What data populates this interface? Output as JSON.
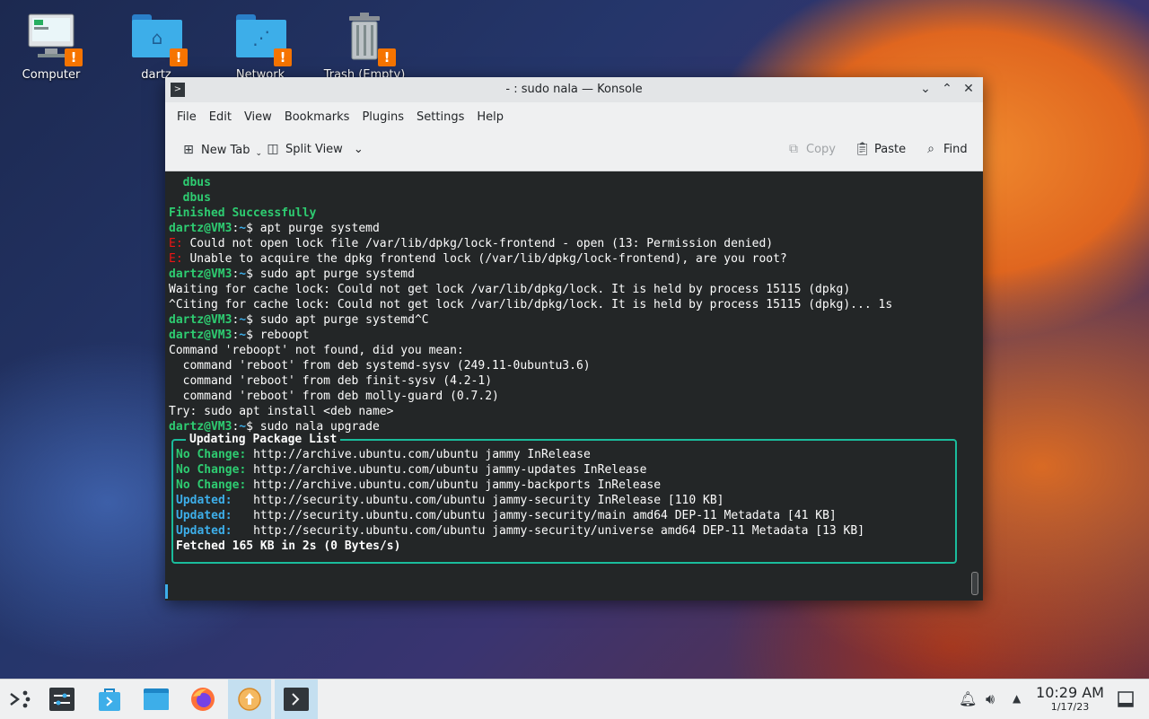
{
  "desktop": {
    "icons": [
      {
        "label": "Computer"
      },
      {
        "label": "dartz"
      },
      {
        "label": "Network"
      },
      {
        "label": "Trash (Empty)"
      }
    ],
    "warn_glyph": "!"
  },
  "window": {
    "title": "- : sudo nala — Konsole",
    "menu": [
      "File",
      "Edit",
      "View",
      "Bookmarks",
      "Plugins",
      "Settings",
      "Help"
    ],
    "toolbar": {
      "new_tab": "New Tab",
      "split_view": "Split View",
      "copy": "Copy",
      "paste": "Paste",
      "find": "Find"
    }
  },
  "terminal": {
    "prompt_user": "dartz@VM3",
    "prompt_path": "~",
    "lines": {
      "l1": "  dbus",
      "l2": "  dbus",
      "l3": "Finished Successfully",
      "l4_cmd": "apt purge systemd",
      "l5_tag": "E:",
      "l5": " Could not open lock file /var/lib/dpkg/lock-frontend - open (13: Permission denied)",
      "l6_tag": "E:",
      "l6": " Unable to acquire the dpkg frontend lock (/var/lib/dpkg/lock-frontend), are you root?",
      "l7_cmd": "sudo apt purge systemd",
      "l8": "Waiting for cache lock: Could not get lock /var/lib/dpkg/lock. It is held by process 15115 (dpkg)",
      "l9": "^Citing for cache lock: Could not get lock /var/lib/dpkg/lock. It is held by process 15115 (dpkg)... 1s",
      "l10_cmd": "sudo apt purge systemd^C",
      "l11_cmd": "reboopt",
      "l12": "Command 'reboopt' not found, did you mean:",
      "l13": "  command 'reboot' from deb systemd-sysv (249.11-0ubuntu3.6)",
      "l14": "  command 'reboot' from deb finit-sysv (4.2-1)",
      "l15": "  command 'reboot' from deb molly-guard (0.7.2)",
      "l16": "Try: sudo apt install <deb name>",
      "l17_cmd": "sudo nala upgrade"
    },
    "nala": {
      "title": "Updating Package List",
      "rows": [
        {
          "status": "No Change:",
          "text": " http://archive.ubuntu.com/ubuntu jammy InRelease"
        },
        {
          "status": "No Change:",
          "text": " http://archive.ubuntu.com/ubuntu jammy-updates InRelease"
        },
        {
          "status": "No Change:",
          "text": " http://archive.ubuntu.com/ubuntu jammy-backports InRelease"
        },
        {
          "status": "Updated:  ",
          "text": " http://security.ubuntu.com/ubuntu jammy-security InRelease [110 KB]"
        },
        {
          "status": "Updated:  ",
          "text": " http://security.ubuntu.com/ubuntu jammy-security/main amd64 DEP-11 Metadata [41 KB]"
        },
        {
          "status": "Updated:  ",
          "text": " http://security.ubuntu.com/ubuntu jammy-security/universe amd64 DEP-11 Metadata [13 KB]"
        }
      ],
      "footer": "Fetched 165 KB in 2s (0 Bytes/s)"
    }
  },
  "taskbar": {
    "clock_time": "10:29 AM",
    "clock_date": "1/17/23"
  },
  "colors": {
    "accent": "#3daee9",
    "prompt_green": "#2ecc71",
    "error_red": "#ed1515",
    "box_teal": "#1abc9c",
    "warning_orange": "#f67400"
  }
}
